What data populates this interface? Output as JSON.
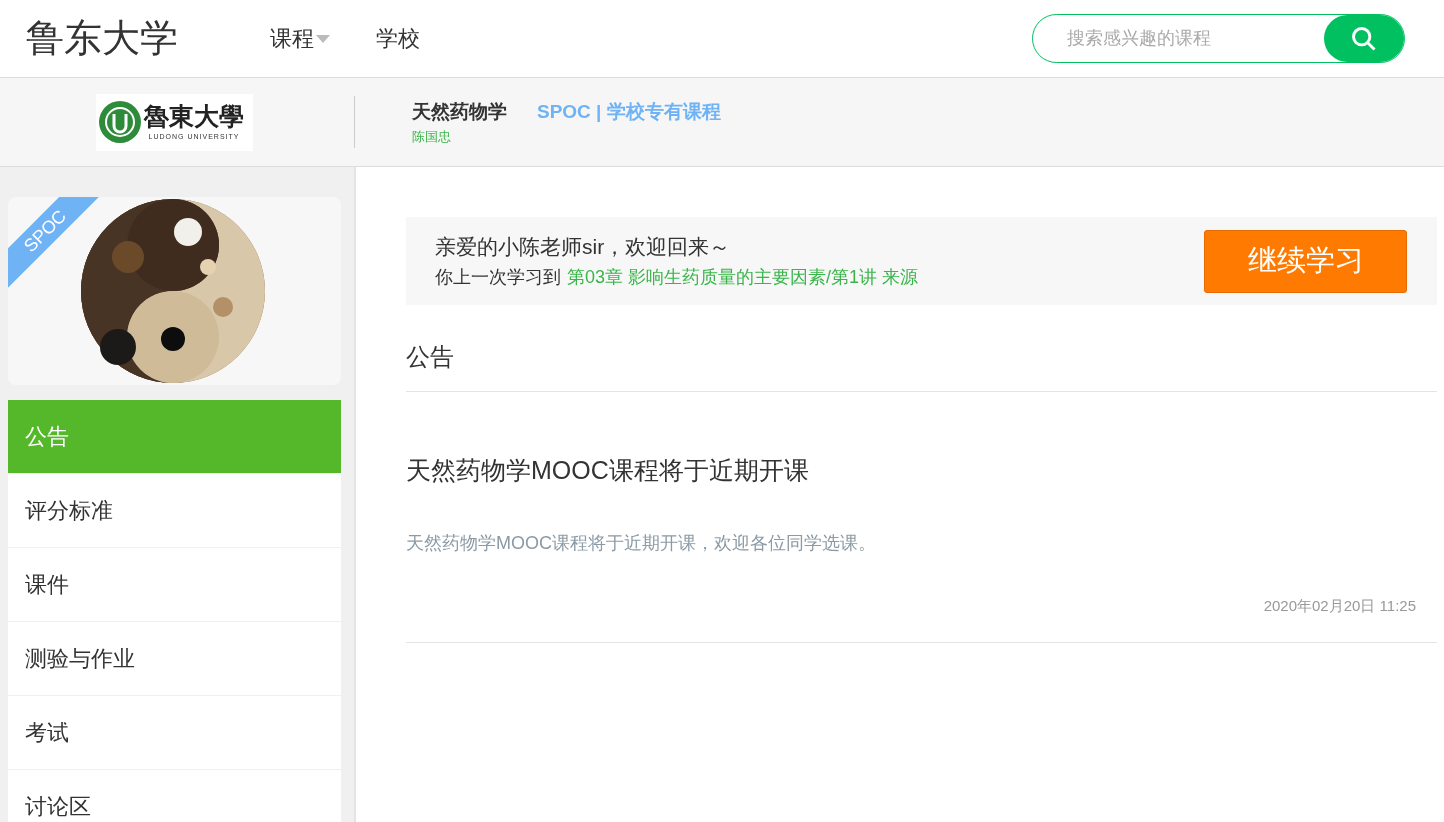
{
  "header": {
    "site_title": "鲁东大学",
    "nav": [
      {
        "label": "课程",
        "dropdown": true
      },
      {
        "label": "学校",
        "dropdown": false
      }
    ],
    "search": {
      "placeholder": "搜索感兴趣的课程"
    }
  },
  "course_bar": {
    "logo_text": "魯東大學",
    "logo_subtext": "LUDONG UNIVERSITY",
    "course_name": "天然药物学",
    "teacher": "陈国忠",
    "course_type": "SPOC | 学校专有课程"
  },
  "sidebar": {
    "cover": {
      "kind": "picture",
      "ribbon": "SPOC"
    },
    "items": [
      {
        "label": "公告",
        "selected": true
      },
      {
        "label": "评分标准",
        "selected": false
      },
      {
        "label": "课件",
        "selected": false
      },
      {
        "label": "测验与作业",
        "selected": false
      },
      {
        "label": "考试",
        "selected": false
      },
      {
        "label": "讨论区",
        "selected": false
      }
    ]
  },
  "welcome": {
    "greeting": "亲爱的小陈老师sir，欢迎回来～",
    "progress_prefix": "你上一次学习到",
    "progress_link": "第03章 影响生药质量的主要因素/第1讲 来源",
    "button": "继续学习"
  },
  "announcements": {
    "title": "公告",
    "items": [
      {
        "title": "天然药物学MOOC课程将于近期开课",
        "body": "天然药物学MOOC课程将于近期开课，欢迎各位同学选课。",
        "time": "2020年02月20日 11:25"
      }
    ]
  }
}
